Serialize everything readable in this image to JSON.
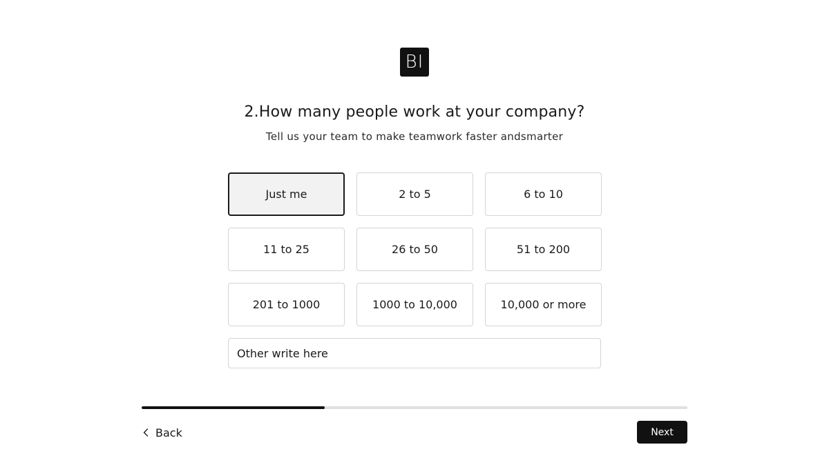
{
  "logo": {
    "text": "BI"
  },
  "question": {
    "title": "2.How many people work at your company?",
    "subtitle": "Tell us your team to make teamwork faster andsmarter"
  },
  "options": [
    {
      "label": "Just me",
      "selected": true
    },
    {
      "label": "2 to 5",
      "selected": false
    },
    {
      "label": "6 to 10",
      "selected": false
    },
    {
      "label": "11 to 25",
      "selected": false
    },
    {
      "label": "26 to 50",
      "selected": false
    },
    {
      "label": "51 to 200",
      "selected": false
    },
    {
      "label": "201 to 1000",
      "selected": false
    },
    {
      "label": "1000 to 10,000",
      "selected": false
    },
    {
      "label": "10,000 or more",
      "selected": false
    }
  ],
  "other_input": {
    "placeholder": "Other write here",
    "value": ""
  },
  "progress": {
    "fraction": 0.335
  },
  "nav": {
    "back_label": "Back",
    "back_icon": "chevron-left-icon",
    "next_label": "Next"
  },
  "colors": {
    "primary": "#111111",
    "border": "#d4d4d4",
    "selected_bg": "#f2f2f2",
    "track": "#e0e0e0"
  }
}
